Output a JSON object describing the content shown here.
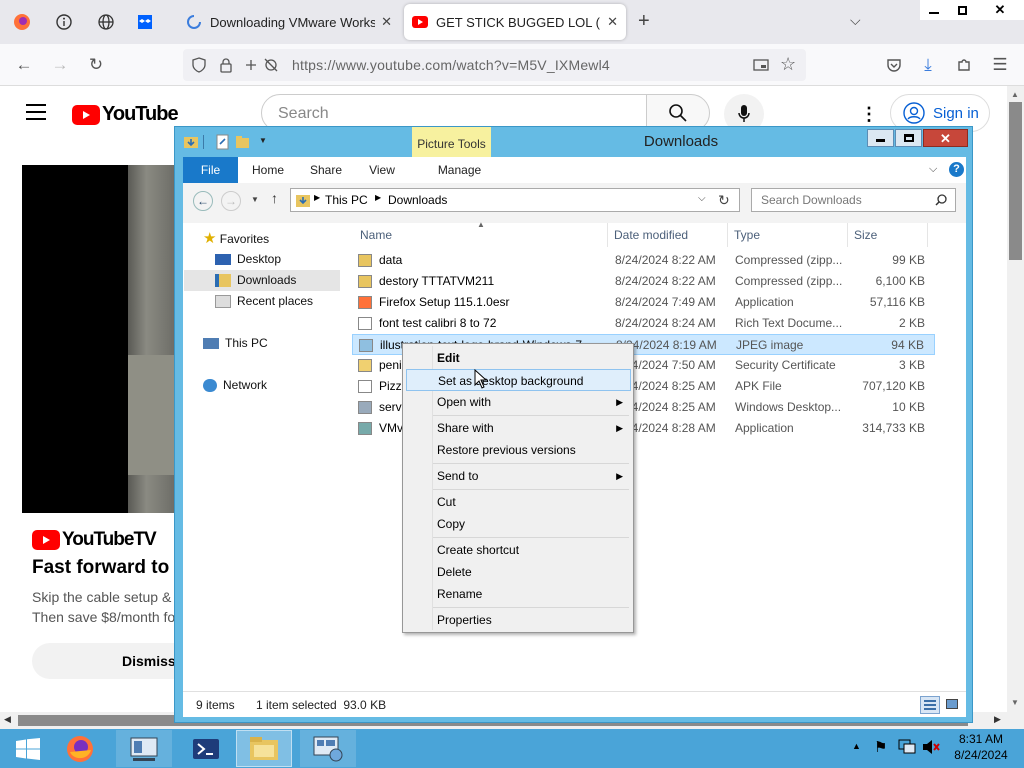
{
  "browser": {
    "tabs": [
      {
        "title": "Downloading VMware Workstati",
        "icon": "spinner-icon"
      },
      {
        "title": "GET STICK BUGGED LOL (EXTEN",
        "icon": "youtube-icon"
      }
    ],
    "url": "https://www.youtube.com/watch?v=M5V_IXMewl4",
    "window_controls": [
      "minimize-icon",
      "restore-icon",
      "close-icon"
    ]
  },
  "youtube": {
    "logo": "YouTube",
    "search_placeholder": "Search",
    "signin": "Sign in",
    "ad": {
      "brand": "YouTubeTV",
      "headline": "Fast forward to",
      "line1": "Skip the cable setup &",
      "line2": "Then save $8/month fo",
      "dismiss": "Dismiss"
    }
  },
  "explorer": {
    "title": "Downloads",
    "picture_tools": "Picture Tools",
    "ribbon": [
      "File",
      "Home",
      "Share",
      "View",
      "Manage"
    ],
    "breadcrumb": [
      "This PC",
      "Downloads"
    ],
    "search_placeholder": "Search Downloads",
    "nav": {
      "favorites": "Favorites",
      "items": [
        "Desktop",
        "Downloads",
        "Recent places"
      ],
      "thispc": "This PC",
      "network": "Network"
    },
    "columns": [
      "Name",
      "Date modified",
      "Type",
      "Size"
    ],
    "files": [
      {
        "name": "data",
        "date": "8/24/2024 8:22 AM",
        "type": "Compressed (zipp...",
        "size": "99 KB",
        "icon": "zip-folder-icon"
      },
      {
        "name": "destory TTTATVM211",
        "date": "8/24/2024 8:22 AM",
        "type": "Compressed (zipp...",
        "size": "6,100 KB",
        "icon": "zip-folder-icon"
      },
      {
        "name": "Firefox Setup 115.1.0esr",
        "date": "8/24/2024 7:49 AM",
        "type": "Application",
        "size": "57,116 KB",
        "icon": "firefox-installer-icon"
      },
      {
        "name": "font test calibri 8 to 72",
        "date": "8/24/2024 8:24 AM",
        "type": "Rich Text Docume...",
        "size": "2 KB",
        "icon": "rtf-document-icon"
      },
      {
        "name": "illustration-text-logo-brand-Windows-7...",
        "date": "8/24/2024 8:19 AM",
        "type": "JPEG image",
        "size": "94 KB",
        "icon": "image-file-icon"
      },
      {
        "name": "peni",
        "date": "8/24/2024 7:50 AM",
        "type": "Security Certificate",
        "size": "3 KB",
        "icon": "certificate-icon"
      },
      {
        "name": "Pizz",
        "date": "8/24/2024 8:25 AM",
        "type": "APK File",
        "size": "707,120 KB",
        "icon": "blank-file-icon"
      },
      {
        "name": "serv",
        "date": "8/24/2024 8:25 AM",
        "type": "Windows Desktop...",
        "size": "10 KB",
        "icon": "desktop-shortcut-icon"
      },
      {
        "name": "VMv",
        "date": "8/24/2024 8:28 AM",
        "type": "Application",
        "size": "314,733 KB",
        "icon": "vmware-installer-icon"
      }
    ],
    "status": {
      "count": "9 items",
      "selected": "1 item selected  93.0 KB"
    }
  },
  "context_menu": [
    {
      "label": "Edit"
    },
    {
      "label": "Set as desktop background"
    },
    {
      "label": "Open with",
      "submenu": true
    },
    {
      "label": "Share with",
      "submenu": true
    },
    {
      "label": "Restore previous versions"
    },
    {
      "label": "Send to",
      "submenu": true
    },
    {
      "label": "Cut"
    },
    {
      "label": "Copy"
    },
    {
      "label": "Create shortcut"
    },
    {
      "label": "Delete"
    },
    {
      "label": "Rename"
    },
    {
      "label": "Properties"
    }
  ],
  "taskbar": {
    "time": "8:31 AM",
    "date": "8/24/2024",
    "apps": [
      "windows-start-icon",
      "firefox-icon",
      "server-manager-icon",
      "powershell-icon",
      "file-explorer-icon",
      "network-settings-icon"
    ]
  },
  "colors": {
    "taskbar": "#4aa4d8",
    "window_frame": "#65bbe4",
    "selection": "#cce8ff",
    "youtube_red": "#ff0000"
  }
}
